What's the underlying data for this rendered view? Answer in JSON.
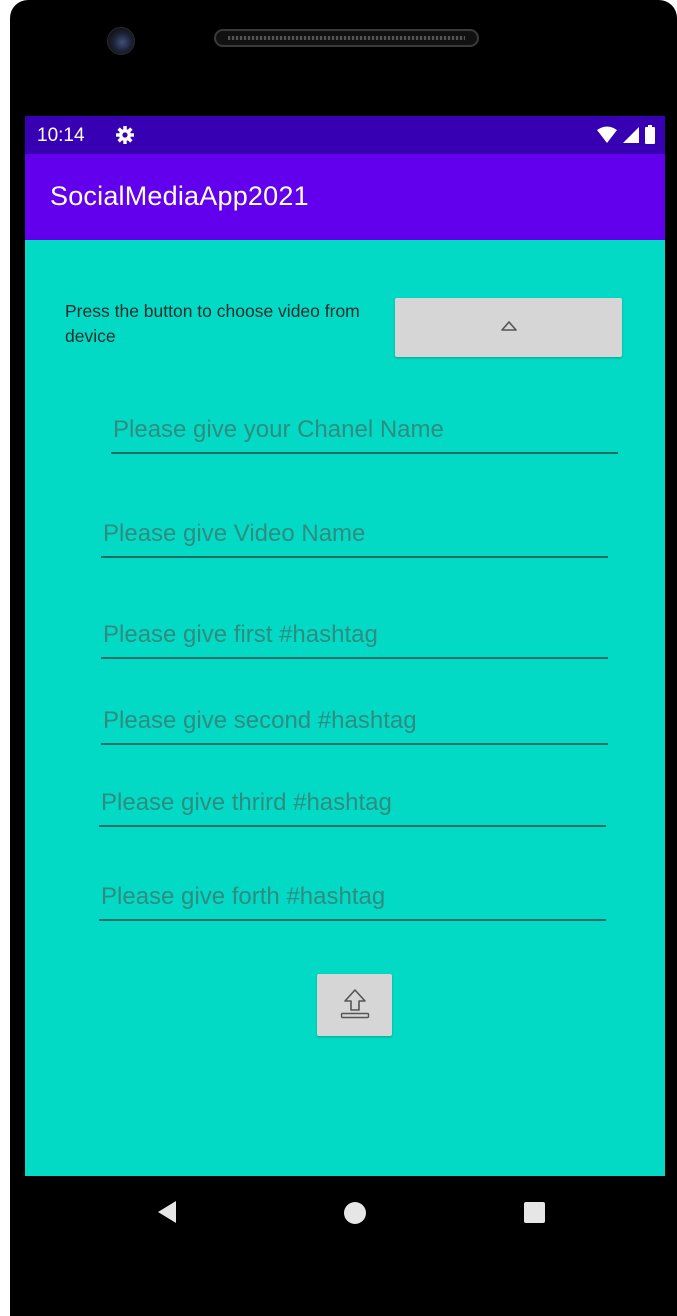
{
  "status_bar": {
    "time": "10:14",
    "icons": [
      "gear-icon",
      "wifi-icon",
      "signal-icon",
      "battery-icon"
    ]
  },
  "app_bar": {
    "title": "SocialMediaApp2021"
  },
  "choose_video": {
    "prompt": "Press the button to choose video from device",
    "button_icon": "eject-arrow-icon"
  },
  "fields": {
    "channel_name": {
      "placeholder": "Please give your Chanel Name",
      "value": ""
    },
    "video_name": {
      "placeholder": "Please give Video Name",
      "value": ""
    },
    "hashtag_1": {
      "placeholder": "Please give first #hashtag",
      "value": ""
    },
    "hashtag_2": {
      "placeholder": "Please give second #hashtag",
      "value": ""
    },
    "hashtag_3": {
      "placeholder": "Please give thrird #hashtag",
      "value": ""
    },
    "hashtag_4": {
      "placeholder": "Please give forth #hashtag",
      "value": ""
    }
  },
  "upload_button": {
    "icon": "upload-icon"
  },
  "nav_bar": {
    "icons": [
      "back-icon",
      "home-icon",
      "recents-icon"
    ]
  },
  "colors": {
    "status_bar": "#3700B3",
    "app_bar": "#6200EE",
    "background": "#03DAC5",
    "button": "#d6d6d6",
    "field_underline": "#1d6e64",
    "placeholder": "#2f8c80"
  }
}
